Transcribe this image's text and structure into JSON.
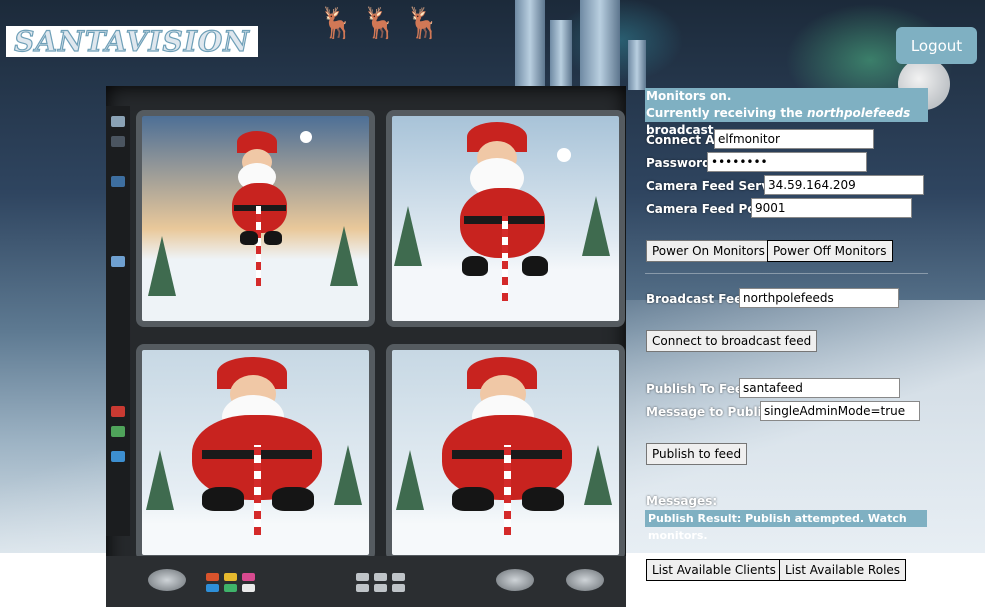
{
  "app": {
    "logo_text": "SANTAVISION",
    "logout_label": "Logout"
  },
  "status": {
    "line1": "Monitors on.",
    "line2_prefix": "Currently receiving the ",
    "line2_feed": "northpolefeeds",
    "line2_suffix": " broadcast"
  },
  "connection": {
    "connect_as_label": "Connect As:",
    "connect_as_value": "elfmonitor",
    "password_label": "Password:",
    "password_value": "••••••••",
    "server_label": "Camera Feed Server:",
    "server_value": "34.59.164.209",
    "port_label": "Camera Feed Port:",
    "port_value": "9001"
  },
  "monitor_buttons": {
    "power_on": "Power On Monitors",
    "power_off": "Power Off Monitors"
  },
  "broadcast": {
    "feed_label": "Broadcast Feed:",
    "feed_value": "northpolefeeds",
    "connect_button": "Connect to broadcast feed"
  },
  "publish": {
    "feed_label": "Publish To Feed:",
    "feed_value": "santafeed",
    "message_label": "Message to Publish:",
    "message_value": "singleAdminMode=true",
    "publish_button": "Publish to feed"
  },
  "messages": {
    "heading": "Messages:",
    "result": "Publish Result: Publish attempted. Watch monitors."
  },
  "bottom_buttons": {
    "list_clients": "List Available Clients",
    "list_roles": "List Available Roles"
  },
  "colors": {
    "accent": "#7fb0c2",
    "button_bg": "#efefef"
  }
}
